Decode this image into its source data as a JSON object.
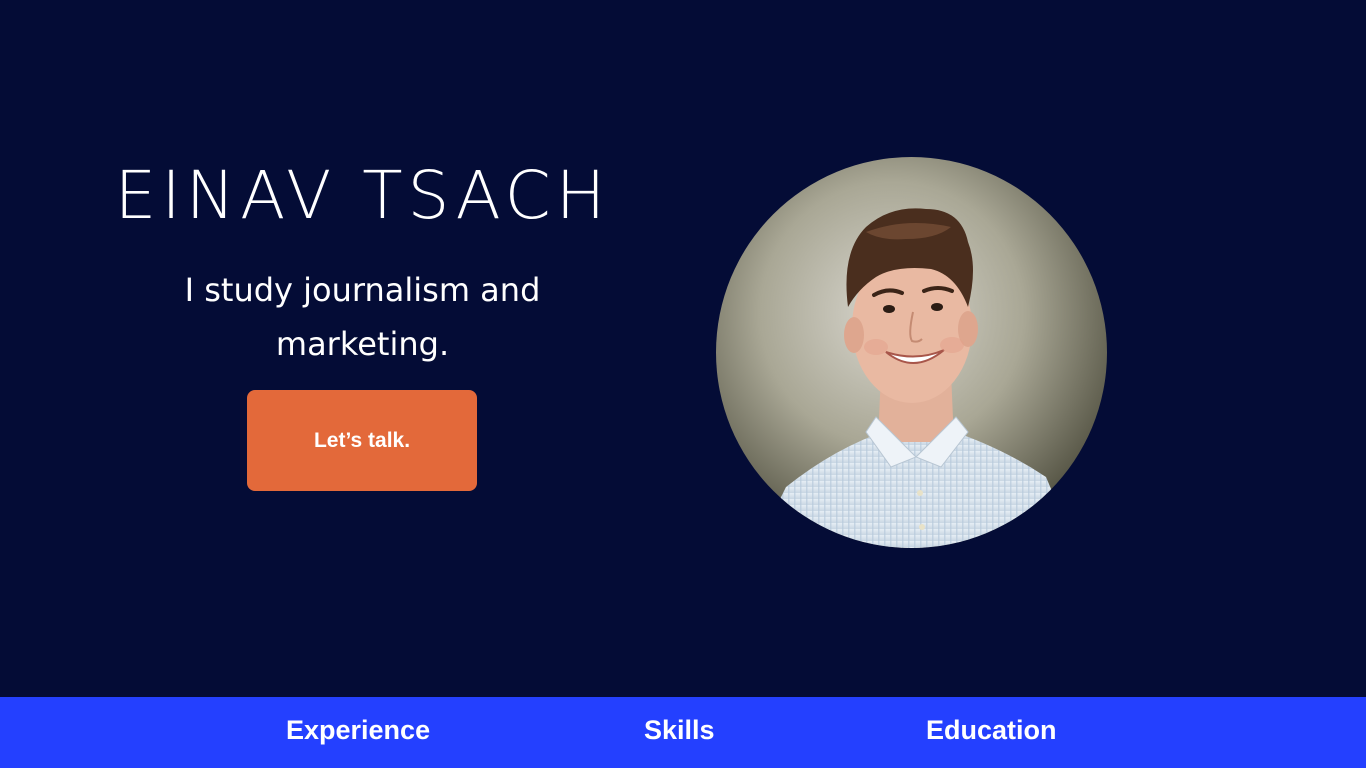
{
  "hero": {
    "name": "EINAV TSACH",
    "tagline": "I study journalism and marketing.",
    "cta_label": "Let’s talk."
  },
  "portrait": {
    "alt": "Einav Tsach"
  },
  "nav": {
    "items": [
      {
        "label": "Experience"
      },
      {
        "label": "Skills"
      },
      {
        "label": "Education"
      }
    ]
  },
  "colors": {
    "background": "#040c36",
    "accent": "#e3693a",
    "nav_bar": "#2440ff",
    "text": "#ffffff"
  }
}
